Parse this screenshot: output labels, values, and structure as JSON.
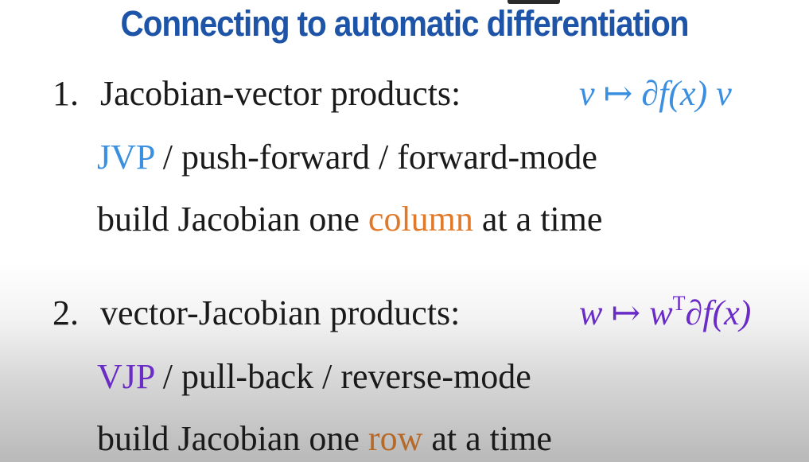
{
  "slide": {
    "title": "Connecting to automatic differentiation"
  },
  "item1": {
    "number": "1.",
    "heading": "Jacobian-vector products:",
    "formula": {
      "v1": "v",
      "map": "↦",
      "partial": "∂",
      "f": "f",
      "arg": "(x)",
      "v2": "v"
    },
    "names": {
      "short": "JVP",
      "rest": " / push-forward / forward-mode"
    },
    "build": {
      "prefix": "build Jacobian one ",
      "keyword": "column",
      "suffix": " at a time"
    }
  },
  "item2": {
    "number": "2.",
    "heading": "vector-Jacobian products:",
    "formula": {
      "w1": "w",
      "map": "↦",
      "w2": "w",
      "transpose": "T",
      "partial": "∂",
      "f": "f",
      "arg": "(x)"
    },
    "names": {
      "short": "VJP",
      "rest": " / pull-back / reverse-mode"
    },
    "build": {
      "prefix": "build Jacobian one ",
      "keyword": "row",
      "suffix": " at a time"
    }
  },
  "colors": {
    "title": "#1e54a8",
    "jvp": "#3a8fe0",
    "vjp": "#6a2bc6",
    "column": "#e07a2a",
    "row": "#b66a2a"
  }
}
